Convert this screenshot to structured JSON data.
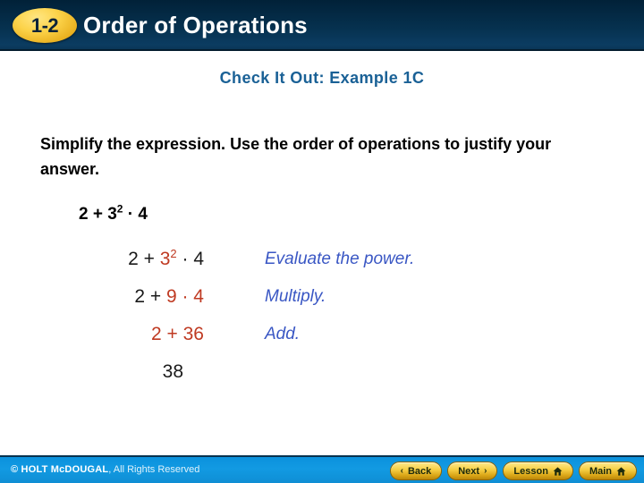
{
  "header": {
    "badge": "1-2",
    "title": "Order of Operations"
  },
  "main": {
    "example_heading": "Check It Out: Example 1C",
    "prompt": "Simplify the expression. Use the order of operations to justify your answer.",
    "main_expression": {
      "pre": "2 + 3",
      "exponent": "2",
      "post": " · 4"
    },
    "steps": [
      {
        "plain_prefix": "2 + ",
        "highlight": "3",
        "highlight_exponent": "2",
        "plain_suffix": " · 4",
        "note": "Evaluate the power."
      },
      {
        "plain_prefix": "2 + ",
        "highlight": "9 · 4",
        "highlight_exponent": "",
        "plain_suffix": "",
        "note": "Multiply."
      },
      {
        "plain_prefix": "",
        "highlight": "2 + 36",
        "highlight_exponent": "",
        "plain_suffix": "",
        "note": "Add."
      }
    ],
    "answer": "38"
  },
  "footer": {
    "copyright_strong": "© HOLT McDOUGAL",
    "copyright_light": ", All Rights Reserved",
    "nav": [
      {
        "label": "Back",
        "chev_left": "‹",
        "chev_right": "",
        "home": false
      },
      {
        "label": "Next",
        "chev_left": "",
        "chev_right": "›",
        "home": false
      },
      {
        "label": "Lesson",
        "chev_left": "",
        "chev_right": "",
        "home": true
      },
      {
        "label": "Main",
        "chev_left": "",
        "chev_right": "",
        "home": true
      }
    ]
  },
  "colors": {
    "header_navy": "#06314f",
    "badge_gold": "#fcd34a",
    "heading_blue": "#1a6196",
    "highlight_red": "#bf3a22",
    "note_blue": "#3a57c4",
    "footer_blue": "#129ae2"
  }
}
